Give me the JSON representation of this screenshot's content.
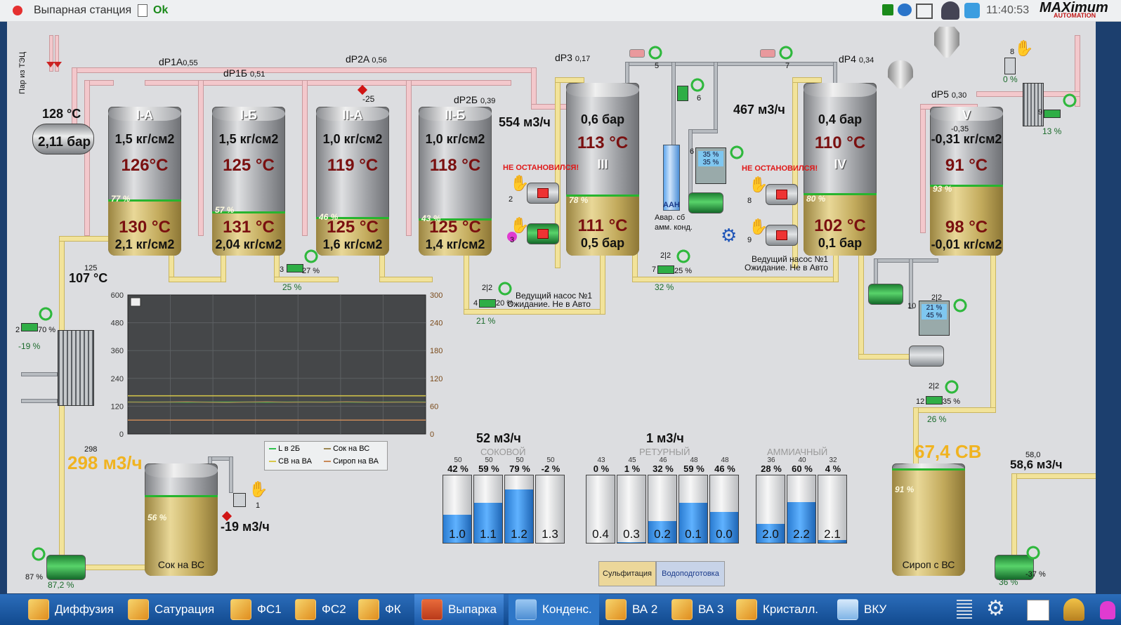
{
  "titlebar": {
    "title": "Выпарная станция",
    "status": "Ok",
    "time": "11:40:53",
    "brand": "MAXimum",
    "brand_sub": "AUTOMATION"
  },
  "header_left": {
    "steam_label": "Пар из ТЭЦ",
    "steam_temp": "128 °C",
    "steam_pressure": "2,11 бар"
  },
  "dp": {
    "dp1a_label": "dP1A",
    "dp1a": "0,55",
    "dp1b_label": "dP1Б",
    "dp1b": "0,51",
    "dp2a_label": "dP2A",
    "dp2a": "0,56",
    "dp2b_label": "dP2Б",
    "dp2b": "0,39",
    "dp3_label": "dP3",
    "dp3": "0,17",
    "dp4_label": "dP4",
    "dp4": "0,34",
    "dp5_label": "dP5",
    "dp5": "0,30"
  },
  "tanks": [
    {
      "name": "I-A",
      "top_pressure": "1,5 кг/см2",
      "top_temp": "126°C",
      "level": "77 %",
      "bot_temp": "130 °C",
      "bot_pressure": "2,1 кг/см2"
    },
    {
      "name": "I-Б",
      "top_pressure": "1,5 кг/см2",
      "top_temp": "125 °C",
      "level": "57 %",
      "bot_temp": "131 °C",
      "bot_pressure": "2,04 кг/см2"
    },
    {
      "name": "II-A",
      "top_pressure": "1,0 кг/см2",
      "top_temp": "119 °C",
      "level": "46 %",
      "bot_temp": "125 °C",
      "bot_pressure": "1,6 кг/см2"
    },
    {
      "name": "II-Б",
      "top_pressure": "1,0 кг/см2",
      "top_temp": "118 °C",
      "level": "43 %",
      "bot_temp": "125 °C",
      "bot_pressure": "1,4 кг/см2"
    },
    {
      "name": "III",
      "top_pressure": "0,6 бар",
      "top_temp": "113 °C",
      "level": "78 %",
      "bot_temp": "111 °C",
      "bot_pressure": "0,5 бар"
    },
    {
      "name": "IV",
      "top_pressure": "0,4 бар",
      "top_temp": "110 °C",
      "level": "80 %",
      "bot_temp": "102 °C",
      "bot_pressure": "0,1 бар"
    },
    {
      "name": "V",
      "top_pressure": "-0,31 кг/см2",
      "top_setpoint": "-0,35",
      "top_temp": "91 °C",
      "level": "93 %",
      "bot_temp": "98 °C",
      "bot_pressure": "-0,01 кг/см2"
    }
  ],
  "flows": {
    "flow_iii": "554 м3/ч",
    "flow_iv": "467 м3/ч",
    "juice_flow": "298 м3/ч",
    "juice_set": "298",
    "ret_flow": "-19 м3/ч",
    "syrup_flow": "58,6 м3/ч",
    "syrup_set": "58,0",
    "syrup_cb": "67,4 СВ",
    "hx_temp": "107 °C",
    "hx_set": "125",
    "sokovoy_total": "52 м3/ч",
    "return_total": "1 м3/ч"
  },
  "alarms": {
    "not_stopped": "НЕ ОСТАНОВИЛСЯ!",
    "lead_pump": "Ведущий насос №1",
    "waiting": "Ожидание. Не в Авто",
    "ammonia_tank": "Авар. сб",
    "ammonia_tank2": "амм. конд.",
    "aah": "ААН"
  },
  "valves": {
    "v1_pct": "70 %",
    "v1_out": "-19 %",
    "v1_num": "2",
    "v3_pct": "27 %",
    "v3_out": "25 %",
    "v3_num": "3",
    "v4_num": "4",
    "v4_pct": "20 %",
    "v4_out": "21 %",
    "v4_sp": "2|2",
    "v5_num": "5",
    "v6_num": "6",
    "v7_num": "7",
    "v7b_num": "7",
    "v7b_pct": "25 %",
    "v7b_out": "32 %",
    "v7b_sp": "2|2",
    "v8_num": "8",
    "v8_pct": "0 %",
    "v9_num": "9",
    "v9_pct": "13 %",
    "v12_num": "12",
    "v12_pct": "35 %",
    "v12_out": "26 %",
    "v12_sp": "2|2",
    "v10_num": "10",
    "v10_sp": "2|2",
    "v10_a": "21 %",
    "v10_b": "45 %",
    "v6d_a": "35 %",
    "v6d_b": "35 %",
    "v6d_num": "6",
    "pump2_num": "2",
    "pump3_num": "3",
    "pump8_num": "8",
    "pump9_num": "9",
    "valve1_num": "1",
    "pump_bl_a": "87 %",
    "pump_bl_b": "87,2 %",
    "pump_br_a": "36 %",
    "pump_br_b": "-37 %"
  },
  "juice_tank": {
    "level": "56 %",
    "name": "Сок на ВС"
  },
  "syrup_tank": {
    "level": "91 %",
    "name": "Сироп с ВС"
  },
  "chart": {
    "legend": [
      "L в 2Б",
      "Сок на ВС",
      "СВ на ВА",
      "Сироп на ВА"
    ],
    "left_ticks": [
      "600",
      "480",
      "360",
      "240",
      "120",
      "0"
    ],
    "right_ticks": [
      "300",
      "240",
      "180",
      "120",
      "60",
      "0"
    ]
  },
  "chart_data": {
    "type": "line",
    "ylim": [
      0,
      600
    ],
    "y2lim": [
      0,
      300
    ],
    "series": [
      {
        "name": "L в 2Б",
        "color": "#2fc24d",
        "values": [
          138,
          138,
          138,
          137,
          138,
          138,
          138,
          137,
          138,
          138,
          138,
          138,
          137,
          138,
          138,
          138
        ]
      },
      {
        "name": "Сок на ВС",
        "color": "#9b8752",
        "values": [
          138,
          137,
          138,
          139,
          137,
          136,
          138,
          139,
          137,
          138,
          137,
          139,
          138,
          137,
          138,
          137
        ]
      },
      {
        "name": "СВ на ВА",
        "color": "#d8c84a",
        "values": [
          165,
          165,
          165,
          165,
          165,
          165,
          165,
          165,
          165,
          165,
          165,
          165,
          165,
          165,
          165,
          165
        ]
      },
      {
        "name": "Сироп на ВА",
        "color": "#c98a58",
        "values": [
          60,
          60,
          60,
          60,
          60,
          60,
          60,
          60,
          60,
          60,
          60,
          60,
          60,
          60,
          60,
          60
        ]
      }
    ]
  },
  "bars": {
    "sokovoy_label": "СОКОВОЙ",
    "return_label": "РЕТУРНЫЙ",
    "ammonia_label": "АММИАЧНЫЙ",
    "groups": [
      {
        "items": [
          {
            "set": "50",
            "pct": "42 %",
            "val": "1.0",
            "fill": 0.42
          },
          {
            "set": "50",
            "pct": "59 %",
            "val": "1.1",
            "fill": 0.59
          },
          {
            "set": "50",
            "pct": "79 %",
            "val": "1.2",
            "fill": 0.79
          },
          {
            "set": "50",
            "pct": "-2 %",
            "val": "1.3",
            "fill": 0.0
          }
        ]
      },
      {
        "items": [
          {
            "set": "43",
            "pct": "0 %",
            "val": "0.4",
            "fill": 0.0
          },
          {
            "set": "45",
            "pct": "1 %",
            "val": "0.3",
            "fill": 0.01
          },
          {
            "set": "46",
            "pct": "32 %",
            "val": "0.2",
            "fill": 0.32
          },
          {
            "set": "48",
            "pct": "59 %",
            "val": "0.1",
            "fill": 0.59
          },
          {
            "set": "48",
            "pct": "46 %",
            "val": "0.0",
            "fill": 0.46
          }
        ]
      },
      {
        "items": [
          {
            "set": "36",
            "pct": "28 %",
            "val": "2.0",
            "fill": 0.28
          },
          {
            "set": "40",
            "pct": "60 %",
            "val": "2.2",
            "fill": 0.6
          },
          {
            "set": "32",
            "pct": "4 %",
            "val": "2.1",
            "fill": 0.04
          }
        ]
      }
    ]
  },
  "tabs": {
    "t1": "Сульфитация",
    "t2": "Водоподготовка"
  },
  "taskbar": [
    "Диффузия",
    "Сатурация",
    "ФС1",
    "ФС2",
    "ФК",
    "Выпарка",
    "Конденс.",
    "ВА 2",
    "ВА 3",
    "Кристалл.",
    "ВКУ"
  ]
}
